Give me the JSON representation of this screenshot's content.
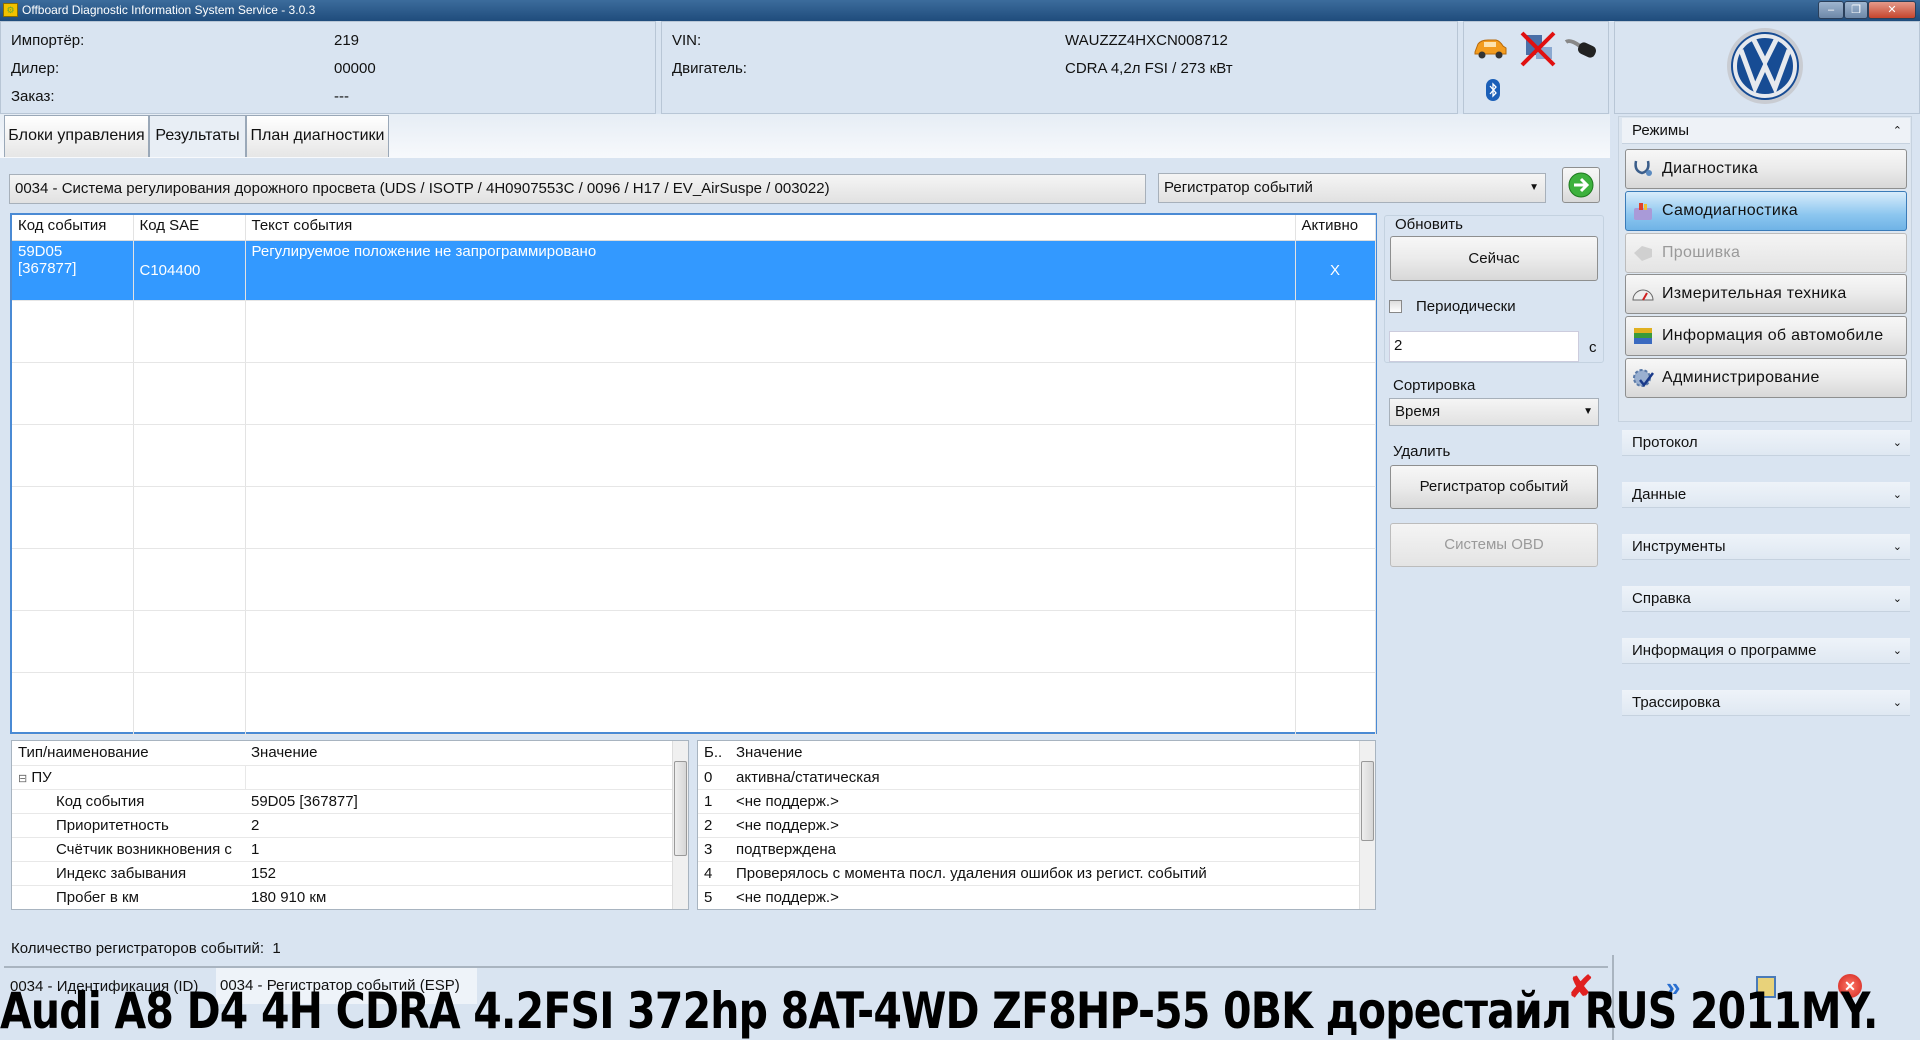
{
  "window": {
    "title": "Offboard Diagnostic Information System Service - 3.0.3"
  },
  "header": {
    "importer_label": "Импортёр:",
    "importer": "219",
    "dealer_label": "Дилер:",
    "dealer": "00000",
    "order_label": "Заказ:",
    "order": "---",
    "vin_label": "VIN:",
    "vin": "WAUZZZ4HXCN008712",
    "engine_label": "Двигатель:",
    "engine": "CDRA 4,2л FSI / 273 кВт"
  },
  "tabs": [
    {
      "label": "Блоки управления"
    },
    {
      "label": "Результаты"
    },
    {
      "label": "План диагностики"
    }
  ],
  "module": {
    "text": "0034 - Система регулирования дорожного просвета  (UDS / ISOTP / 4H0907553C  / 0096 / H17 / EV_AirSuspe / 003022)",
    "dropdown": "Регистратор событий"
  },
  "events_table": {
    "headers": [
      "Код события",
      "Код SAE",
      "Текст события",
      "Активно"
    ],
    "rows": [
      {
        "code": "59D05",
        "code2": "[367877]",
        "sae": "C104400",
        "text": "Регулируемое положение не запрограммировано",
        "active": "X"
      }
    ]
  },
  "controls": {
    "refresh_label": "Обновить",
    "now_button": "Сейчас",
    "periodic_label": "Периодически",
    "periodic_checked": false,
    "interval": "2",
    "interval_unit": "с",
    "sort_label": "Сортировка",
    "sort_value": "Время",
    "delete_label": "Удалить",
    "delete_events_button": "Регистратор событий",
    "obd_button": "Системы OBD"
  },
  "details": {
    "headers": [
      "Тип/наименование",
      "Значение"
    ],
    "group": "ПУ",
    "rows": [
      {
        "name": "Код события",
        "value": "59D05 [367877]"
      },
      {
        "name": "Приоритетность",
        "value": "2"
      },
      {
        "name": "Счётчик возникновения с",
        "value": "1"
      },
      {
        "name": "Индекс забывания",
        "value": "152"
      },
      {
        "name": "Пробег в км",
        "value": "180 910 км"
      }
    ]
  },
  "status_bits": {
    "headers": [
      "Б..",
      "Значение"
    ],
    "rows": [
      {
        "bit": "0",
        "value": "активна/статическая"
      },
      {
        "bit": "1",
        "value": "<не поддерж.>"
      },
      {
        "bit": "2",
        "value": "<не поддерж.>"
      },
      {
        "bit": "3",
        "value": "подтверждена"
      },
      {
        "bit": "4",
        "value": "Проверялось с момента посл. удаления ошибок из регист. событий"
      },
      {
        "bit": "5",
        "value": "<не поддерж.>"
      }
    ]
  },
  "footer": {
    "count_label": "Количество регистраторов событий:",
    "count": "1",
    "bottom_tabs": [
      {
        "label": "0034 - Идентификация (ID)"
      },
      {
        "label": "0034 - Регистратор событий (ESP)"
      }
    ]
  },
  "sidebar": {
    "modes_title": "Режимы",
    "modes": [
      {
        "label": "Диагностика"
      },
      {
        "label": "Самодиагностика"
      },
      {
        "label": "Прошивка"
      },
      {
        "label": "Измерительная техника"
      },
      {
        "label": "Информация об автомобиле"
      },
      {
        "label": "Администрирование"
      }
    ],
    "sections": [
      {
        "label": "Протокол"
      },
      {
        "label": "Данные"
      },
      {
        "label": "Инструменты"
      },
      {
        "label": "Справка"
      },
      {
        "label": "Информация о программе"
      },
      {
        "label": "Трассировка"
      }
    ]
  },
  "overlay_caption": "Audi A8 D4 4H CDRA 4.2FSI 372hp 8AT-4WD ZF8HP-55 0BK дорестайл RUS 2011MY.",
  "colors": {
    "selection": "#3399ff",
    "accent": "#2f6fb3"
  }
}
